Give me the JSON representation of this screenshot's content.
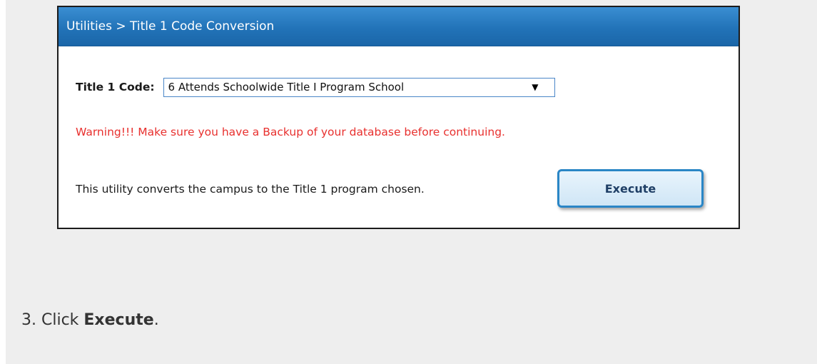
{
  "window": {
    "title": "Utilities > Title 1 Code Conversion"
  },
  "form": {
    "code_label": "Title 1 Code:",
    "code_select": {
      "selected": "6 Attends Schoolwide Title I Program School"
    },
    "warning": "Warning!!! Make sure you have a Backup of your database before continuing.",
    "description": "This utility converts the campus to the Title 1 program chosen.",
    "execute_label": "Execute"
  },
  "instructions": {
    "step_prefix": "3. Click ",
    "step_action": "Execute",
    "step_suffix": "."
  },
  "colors": {
    "titlebar": "#2273b8",
    "warning": "#e8302e",
    "button_border": "#2a86c6",
    "background": "#eeeeee"
  },
  "icons": {
    "dropdown": "chevron-down-icon"
  }
}
